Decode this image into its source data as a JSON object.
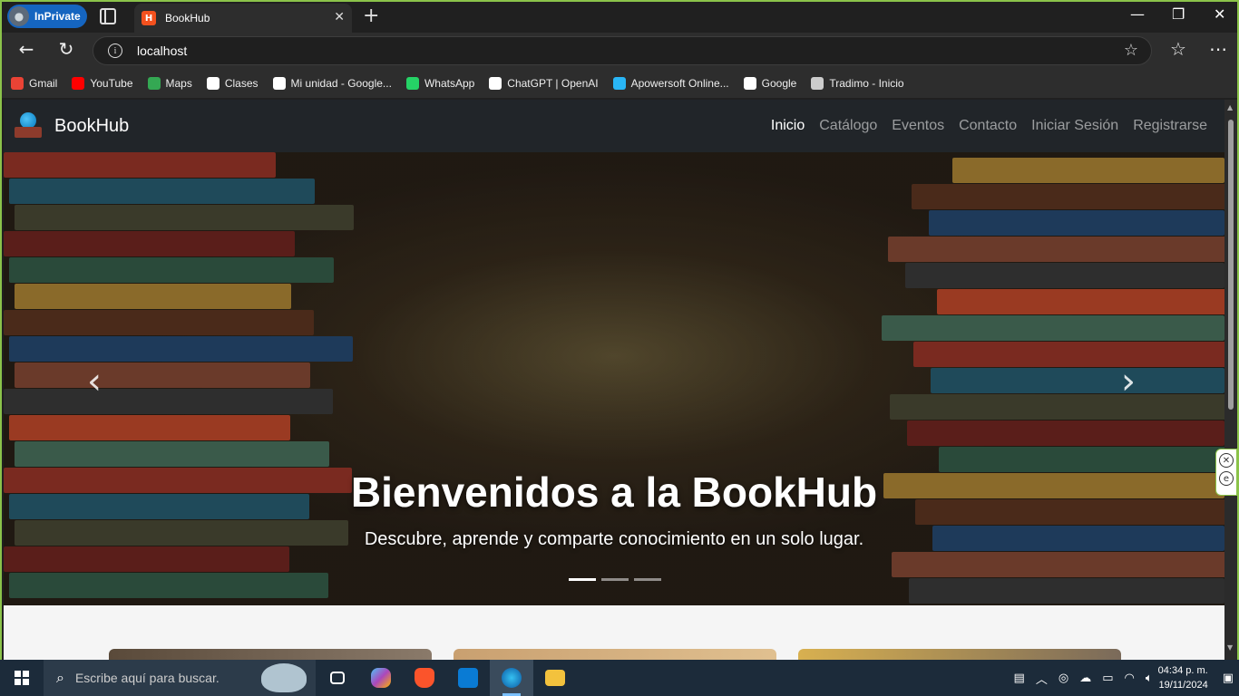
{
  "browser": {
    "inprivate_label": "InPrivate",
    "tab_title": "BookHub",
    "url": "localhost",
    "bookmarks": [
      {
        "label": "Gmail",
        "icon": "gmail-icon",
        "color": "#ea4335"
      },
      {
        "label": "YouTube",
        "icon": "youtube-icon",
        "color": "#ff0000"
      },
      {
        "label": "Maps",
        "icon": "maps-icon",
        "color": "#34a853"
      },
      {
        "label": "Clases",
        "icon": "google-icon",
        "color": "#ffffff"
      },
      {
        "label": "Mi unidad - Google...",
        "icon": "google-icon",
        "color": "#ffffff"
      },
      {
        "label": "WhatsApp",
        "icon": "whatsapp-icon",
        "color": "#25d366"
      },
      {
        "label": "ChatGPT | OpenAI",
        "icon": "chatgpt-icon",
        "color": "#ffffff"
      },
      {
        "label": "Apowersoft Online...",
        "icon": "apowersoft-icon",
        "color": "#29b6f6"
      },
      {
        "label": "Google",
        "icon": "google-icon",
        "color": "#ffffff"
      },
      {
        "label": "Tradimo - Inicio",
        "icon": "tradimo-icon",
        "color": "#cccccc"
      }
    ]
  },
  "site": {
    "brand": "BookHub",
    "nav": [
      "Inicio",
      "Catálogo",
      "Eventos",
      "Contacto",
      "Iniciar Sesión",
      "Registrarse"
    ],
    "active_nav": "Inicio",
    "hero_title": "Bienvenidos a la BookHub",
    "hero_subtitle": "Descubre, aprende y comparte conocimiento en un solo lugar.",
    "carousel_slides": 3,
    "carousel_active": 1
  },
  "taskbar": {
    "search_placeholder": "Escribe aquí para buscar.",
    "time": "04:34 p. m.",
    "date": "19/11/2024"
  }
}
